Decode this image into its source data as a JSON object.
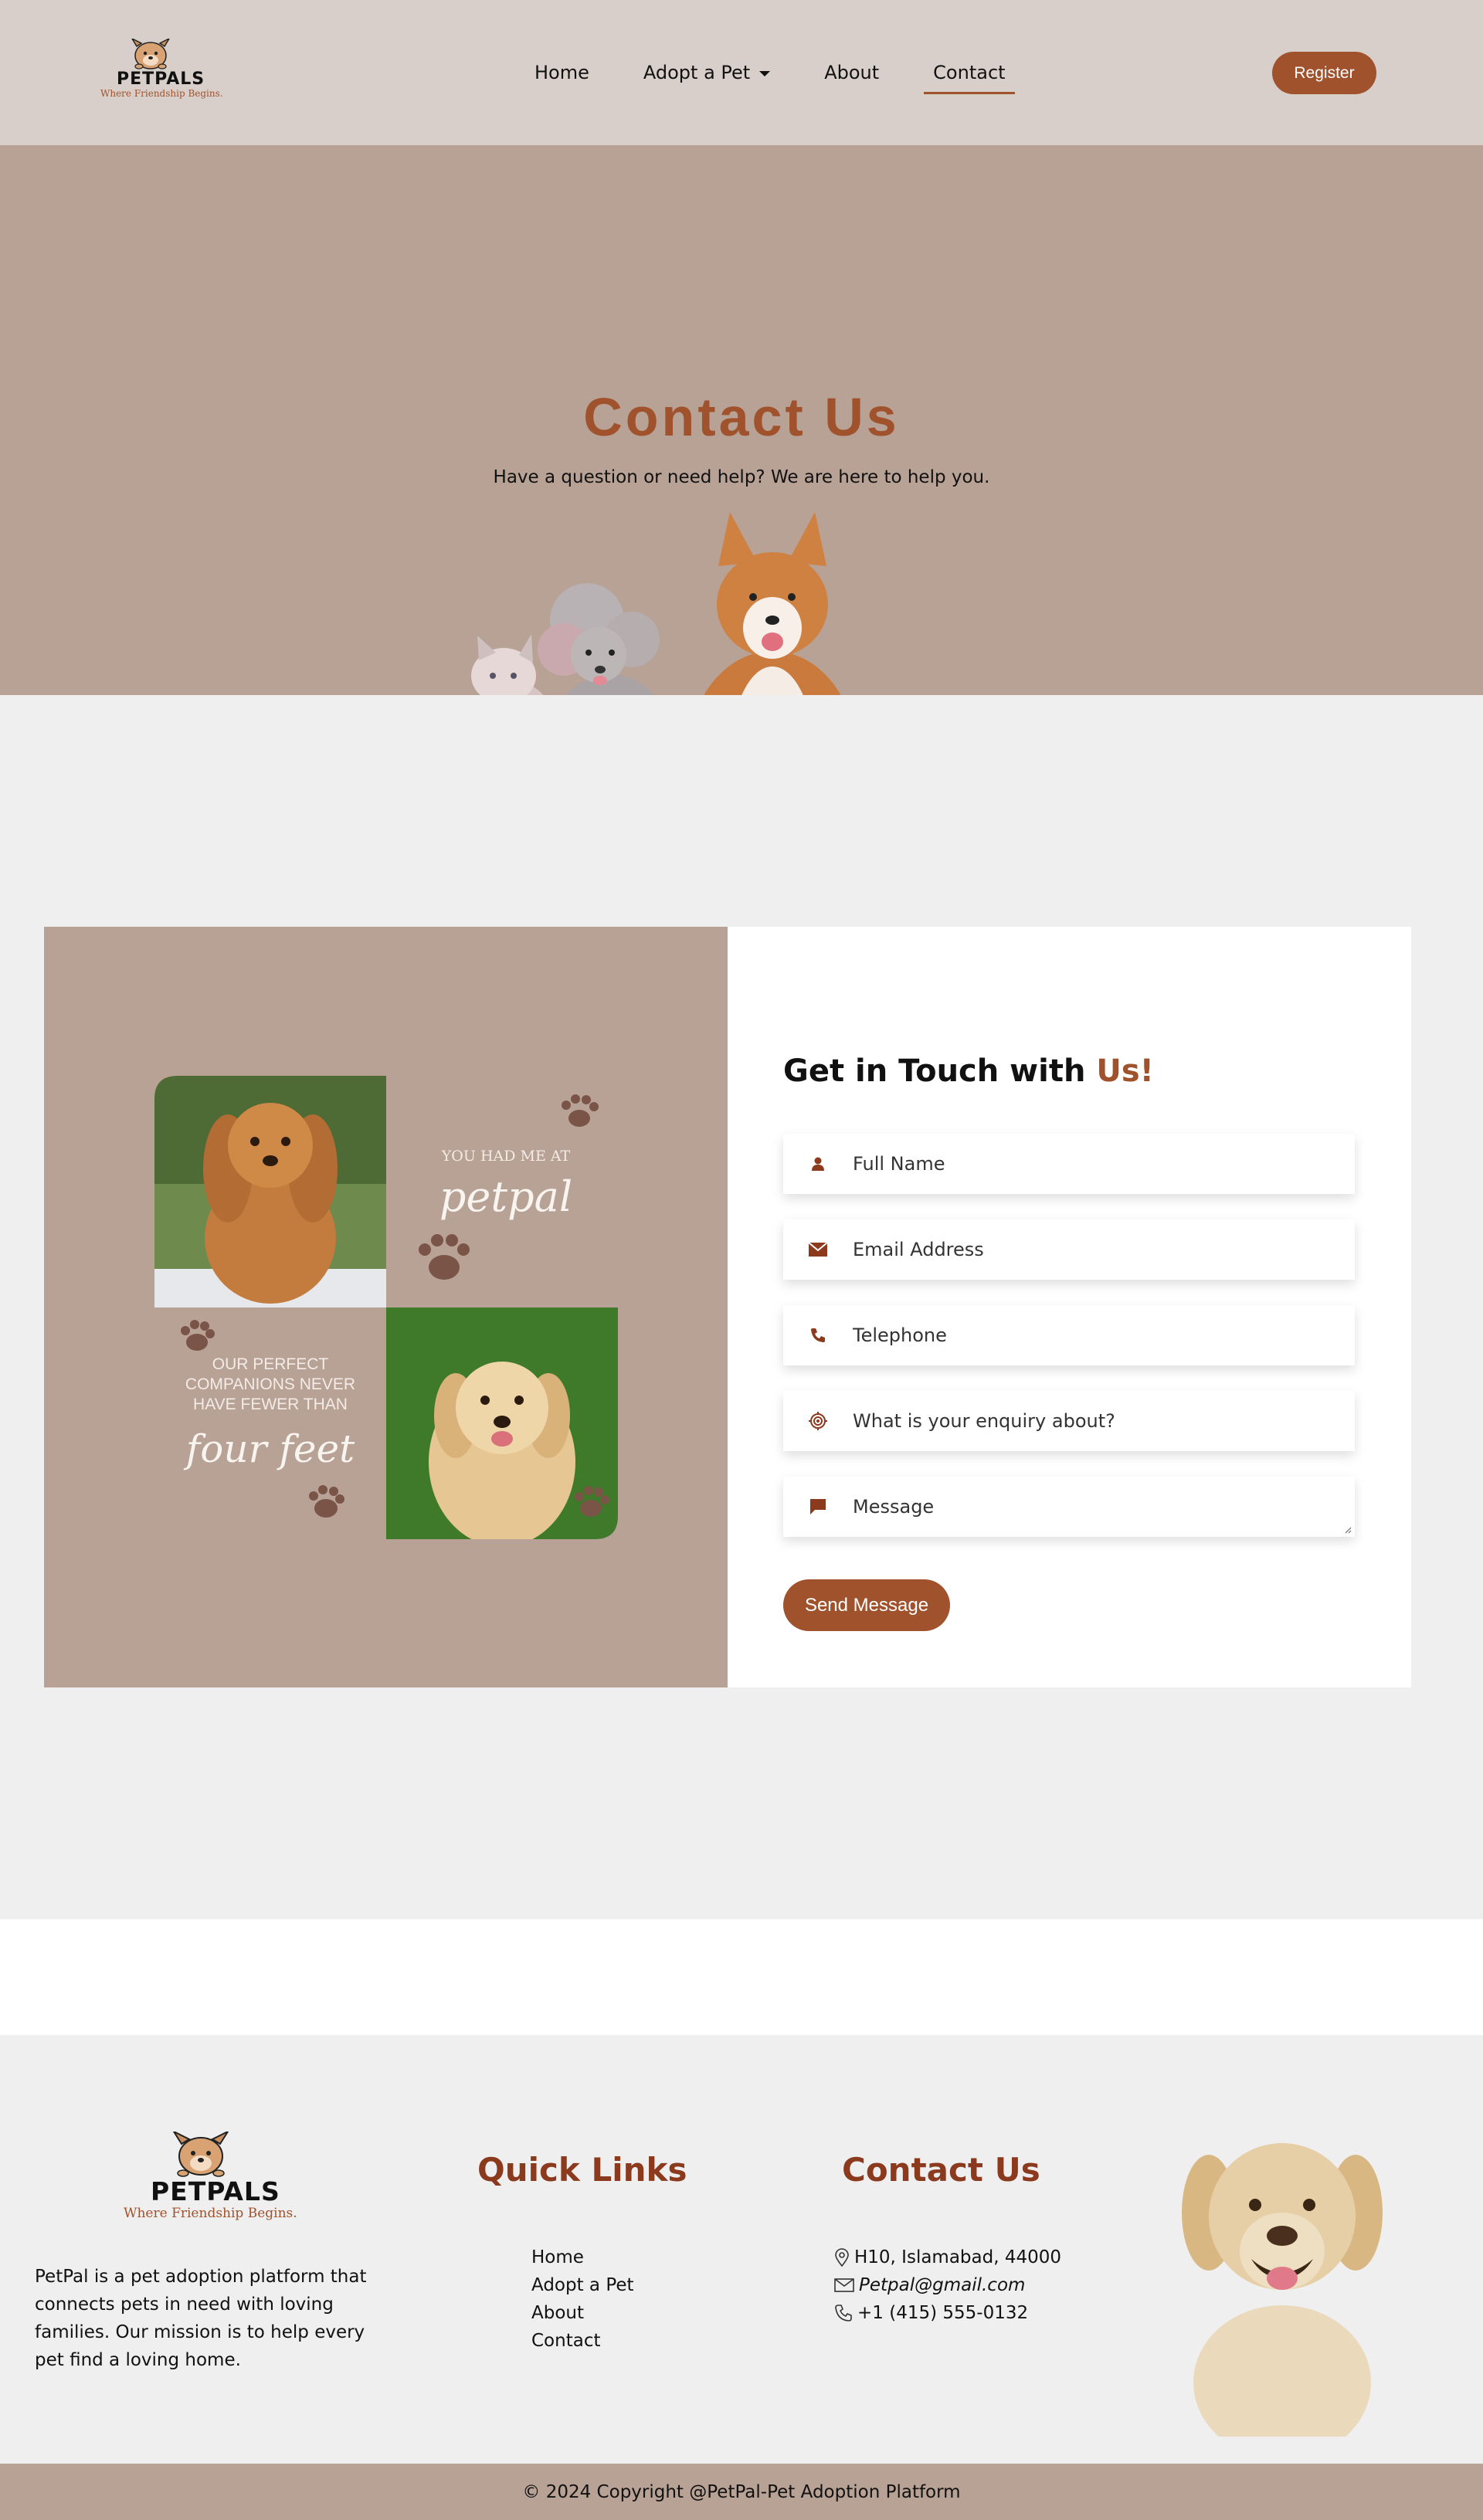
{
  "brand": {
    "name": "PETPALS",
    "tagline": "Where Friendship Begins."
  },
  "nav": {
    "items": [
      {
        "label": "Home"
      },
      {
        "label": "Adopt a Pet"
      },
      {
        "label": "About"
      },
      {
        "label": "Contact"
      }
    ],
    "active": "Contact",
    "register_label": "Register"
  },
  "hero": {
    "title": "Contact Us",
    "subtitle": "Have a question or need help? We are here to help you."
  },
  "collage": {
    "line1": "YOU HAD ME AT",
    "script1": "petpal",
    "line2a": "OUR PERFECT",
    "line2b": "COMPANIONS NEVER",
    "line2c": "HAVE FEWER THAN",
    "script2": "four feet"
  },
  "form": {
    "title_main": "Get in Touch with ",
    "title_accent": "Us!",
    "fields": [
      {
        "placeholder": "Full Name",
        "icon": "person-icon"
      },
      {
        "placeholder": "Email Address",
        "icon": "envelope-icon"
      },
      {
        "placeholder": "Telephone",
        "icon": "phone-icon"
      },
      {
        "placeholder": "What is your enquiry about?",
        "icon": "target-icon"
      },
      {
        "placeholder": "Message",
        "icon": "chat-icon"
      }
    ],
    "submit_label": "Send Message"
  },
  "footer": {
    "about": "PetPal is a pet adoption platform that connects pets in need with loving families. Our mission is to help every pet find a loving home.",
    "quick_links_title": "Quick Links",
    "quick_links": [
      "Home",
      "Adopt a Pet",
      "About",
      "Contact"
    ],
    "contact_title": "Contact Us",
    "address": "H10, Islamabad, 44000",
    "email": "Petpal@gmail.com",
    "phone": "+1 (415) 555-0132",
    "copyright": "© 2024 Copyright @PetPal-Pet Adoption Platform"
  },
  "colors": {
    "accent": "#a0522d",
    "nav_bg": "#d8cfca",
    "hero_bg": "#b8a195",
    "page_bg": "#efefef"
  }
}
